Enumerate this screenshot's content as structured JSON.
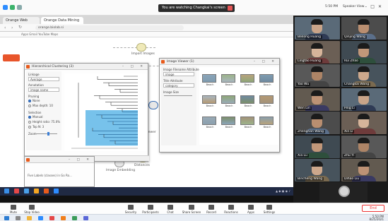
{
  "zoom": {
    "sharing_banner": "You are watching Changkai's screen",
    "window_controls": [
      "–",
      "□",
      "✕"
    ],
    "view_button": "Speaker View",
    "end_button": "End",
    "toolbar": [
      {
        "label": "Mute",
        "icon": "microphone-icon"
      },
      {
        "label": "Stop Video",
        "icon": "camera-icon"
      },
      {
        "label": "Security",
        "icon": "shield-icon"
      },
      {
        "label": "Participants",
        "icon": "people-icon"
      },
      {
        "label": "Chat",
        "icon": "chat-icon"
      },
      {
        "label": "Share Screen",
        "icon": "share-screen-icon"
      },
      {
        "label": "Record",
        "icon": "record-icon"
      },
      {
        "label": "Reactions",
        "icon": "smile-icon"
      },
      {
        "label": "Apps",
        "icon": "apps-icon"
      },
      {
        "label": "Settings",
        "icon": "gear-icon"
      }
    ]
  },
  "browser": {
    "tabs": [
      "Orange Web",
      "Orange Data Mining"
    ],
    "url": "orange.biolab.si",
    "bookmarks": "Apps  Gmail  YouTube  Maps"
  },
  "hc_window": {
    "title": "Hierarchical Clustering (3)",
    "linkage_label": "Linkage",
    "linkage_value": "Average",
    "annotation_label": "Annotation",
    "annotation_value": "image name",
    "pruning_label": "Pruning",
    "pruning_none": "None",
    "pruning_max": "Max depth: 10",
    "selection_label": "Selection",
    "selection_manual": "Manual",
    "selection_height": "Height ratio: 75.0%",
    "selection_top": "Top N: 3",
    "zoom_label": "Zoom"
  },
  "iv_window": {
    "title": "Image Viewer (1)",
    "image_filename_label": "Image Filename Attribute",
    "image_filename_value": "image",
    "title_attr_label": "Title Attribute",
    "title_attr_value": "category",
    "image_size_label": "Image Size",
    "thumbnails": [
      "Beach",
      "Beach",
      "Beach",
      "Beach",
      "Beach",
      "Beach",
      "Beach",
      "Beach",
      "Beach",
      "Beach",
      "Beach",
      "Beach"
    ]
  },
  "dt_window": {
    "text": "Five Labels (classes) in Go Ro..."
  },
  "canvas_widgets": {
    "import_images": "Import Images",
    "image_embedding": "Image Embedding",
    "distances": "Distances",
    "image_viewer": "Image Viewer",
    "hierarchical": "Hierarchical Clustering"
  },
  "participants": [
    {
      "name": "Beilong Huang"
    },
    {
      "name": "Qinjing Wang"
    },
    {
      "name": "Lingtao Huang"
    },
    {
      "name": "Rui Zhao"
    },
    {
      "name": "Yao Wu"
    },
    {
      "name": "Changkai Wang"
    },
    {
      "name": "Wen Lin"
    },
    {
      "name": "Ping Li"
    },
    {
      "name": "Zhenghan Wang"
    },
    {
      "name": "Xin Li"
    },
    {
      "name": "Xia Lu"
    },
    {
      "name": "Zhu Yi"
    },
    {
      "name": "Bincheng Wang"
    },
    {
      "name": "Dihao Liu"
    }
  ],
  "taskbar": {
    "time": "5:50 PM",
    "date": "8/25/2021"
  },
  "chart_data": {
    "type": "bar",
    "note_type": "dendrogram",
    "highlight_color": "#5fb7e8",
    "leaf_count": 22,
    "selected_leaves": [
      11,
      21
    ]
  }
}
